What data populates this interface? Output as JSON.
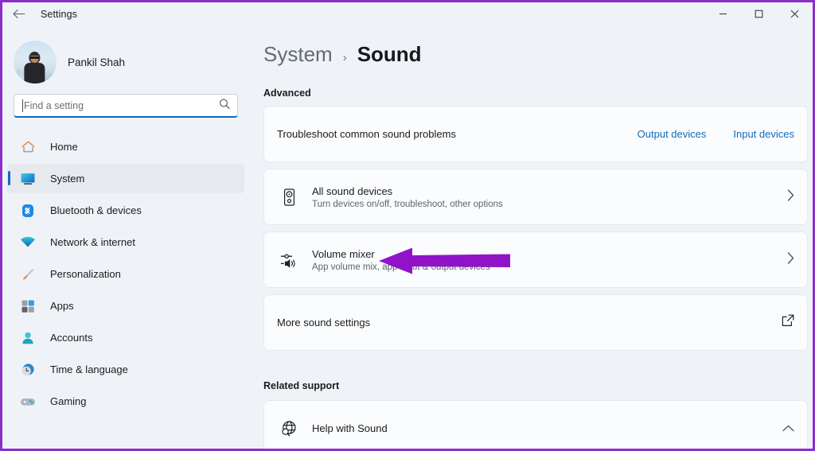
{
  "window": {
    "title": "Settings",
    "back_icon": "back-arrow-icon",
    "controls": [
      {
        "name": "minimize-button",
        "glyph": "minimize-icon"
      },
      {
        "name": "maximize-button",
        "glyph": "maximize-icon"
      },
      {
        "name": "close-button",
        "glyph": "close-icon"
      }
    ]
  },
  "sidebar": {
    "profile": {
      "name": "Pankil Shah",
      "avatar_icon": "user-avatar"
    },
    "search": {
      "placeholder": "Find a setting",
      "value": "",
      "icon": "search-icon"
    },
    "items": [
      {
        "label": "Home",
        "icon": "home-icon",
        "selected": false
      },
      {
        "label": "System",
        "icon": "system-icon",
        "selected": true
      },
      {
        "label": "Bluetooth & devices",
        "icon": "bluetooth-icon",
        "selected": false
      },
      {
        "label": "Network & internet",
        "icon": "wifi-icon",
        "selected": false
      },
      {
        "label": "Personalization",
        "icon": "paintbrush-icon",
        "selected": false
      },
      {
        "label": "Apps",
        "icon": "apps-icon",
        "selected": false
      },
      {
        "label": "Accounts",
        "icon": "accounts-icon",
        "selected": false
      },
      {
        "label": "Time & language",
        "icon": "clock-icon",
        "selected": false
      },
      {
        "label": "Gaming",
        "icon": "gamepad-icon",
        "selected": false
      }
    ]
  },
  "main": {
    "breadcrumb": {
      "parent": "System",
      "separator": "›",
      "current": "Sound"
    },
    "advanced_heading": "Advanced",
    "troubleshoot": {
      "title": "Troubleshoot common sound problems",
      "output_link": "Output devices",
      "input_link": "Input devices"
    },
    "all_sound_devices": {
      "title": "All sound devices",
      "subtitle": "Turn devices on/off, troubleshoot, other options",
      "icon": "speaker-device-icon",
      "chevron": "chevron-right-icon"
    },
    "volume_mixer": {
      "title": "Volume mixer",
      "subtitle": "App volume mix, app input & output devices",
      "icon": "volume-mixer-icon",
      "chevron": "chevron-right-icon"
    },
    "more_sound_settings": {
      "title": "More sound settings",
      "icon": "open-external-icon"
    },
    "related_heading": "Related support",
    "help": {
      "title": "Help with Sound",
      "icon": "globe-search-icon",
      "chevron": "chevron-up-icon"
    }
  },
  "annotation": {
    "arrow_color": "#9013c8",
    "points_at": "Volume mixer"
  },
  "colors": {
    "page_background": "#eff3f8",
    "card_surface": "#fbfcfe",
    "accent_link": "#0f6cbd",
    "selection_indicator": "#0f6cbd",
    "annotation_purple": "#9013c8",
    "frame_border": "#8b2fc9"
  }
}
